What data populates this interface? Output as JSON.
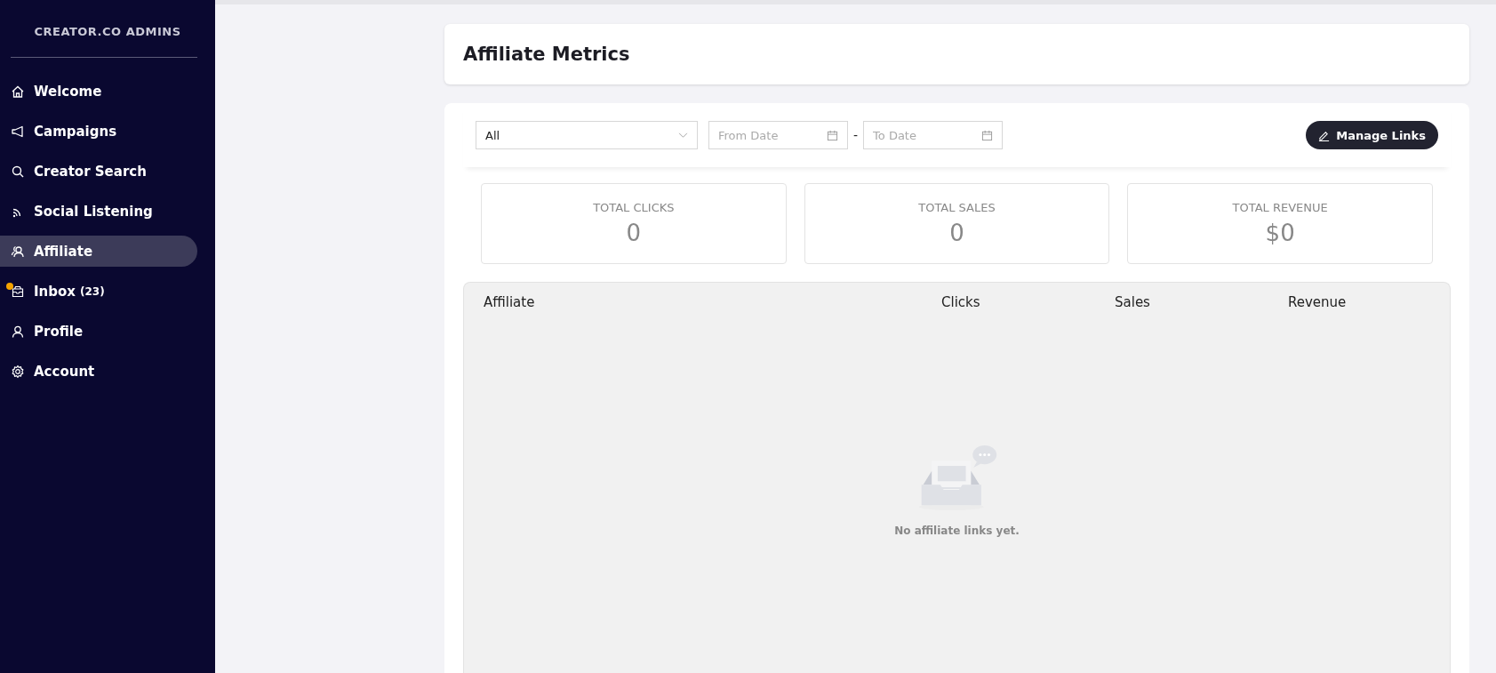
{
  "sidebar": {
    "title": "CREATOR.CO ADMINS",
    "items": [
      {
        "label": "Welcome",
        "selected": false
      },
      {
        "label": "Campaigns",
        "selected": false
      },
      {
        "label": "Creator Search",
        "selected": false
      },
      {
        "label": "Social Listening",
        "selected": false
      },
      {
        "label": "Affiliate",
        "selected": true
      },
      {
        "label": "Inbox",
        "count": "(23)",
        "selected": false,
        "notification": true
      },
      {
        "label": "Profile",
        "selected": false
      },
      {
        "label": "Account",
        "selected": false
      }
    ]
  },
  "page_title": "Affiliate Metrics",
  "filters": {
    "select_value": "All",
    "from_placeholder": "From Date",
    "separator": "-",
    "to_placeholder": "To Date",
    "button": "Manage Links"
  },
  "stats": [
    {
      "label": "TOTAL CLICKS",
      "value": "0"
    },
    {
      "label": "TOTAL SALES",
      "value": "0"
    },
    {
      "label": "TOTAL REVENUE",
      "value": "$0"
    }
  ],
  "table": {
    "columns": [
      "Affiliate",
      "Clicks",
      "Sales",
      "Revenue"
    ],
    "empty_message": "No affiliate links yet."
  }
}
